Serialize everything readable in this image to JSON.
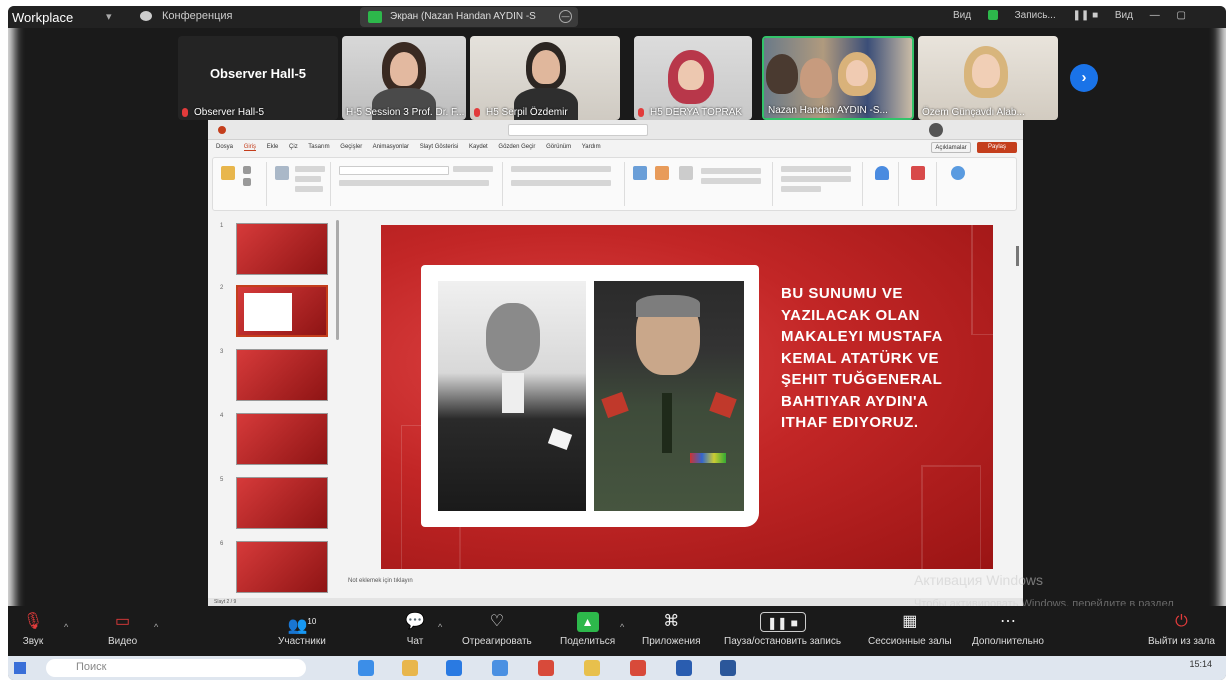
{
  "titlebar": {
    "app": "Workplace",
    "conference": "Конференция",
    "tab": "Экран (Nazan Handan AYDIN -S",
    "view": "Вид",
    "recording": "Запись...",
    "layout": "Вид"
  },
  "participants": [
    {
      "big": "Observer Hall-5",
      "name": "Observer Hall-5"
    },
    {
      "name": "H-5 Session 3 Prof. Dr. F..."
    },
    {
      "name": "H5 Serpil Özdemir"
    },
    {
      "name": "H5 DERYA TOPRAK"
    },
    {
      "name": "Nazan Handan AYDIN -S..."
    },
    {
      "name": "Özem Günçavdı Alab..."
    }
  ],
  "ppt": {
    "tabs": [
      "Dosya",
      "Giriş",
      "Ekle",
      "Çiz",
      "Tasarım",
      "Geçişler",
      "Animasyonlar",
      "Slayt Gösterisi",
      "Kaydet",
      "Gözden Geçir",
      "Görünüm",
      "Yardım"
    ],
    "comments": "Açıklamalar",
    "share": "Paylaş",
    "notes": "Not eklemek için tıklayın",
    "status": "Slayt 2 / 9"
  },
  "slide": {
    "text": "BU SUNUMU VE YAZILACAK OLAN MAKALEYI MUSTAFA KEMAL ATATÜRK VE ŞEHIT TUĞGENERAL BAHTIYAR AYDIN'A ITHAF EDIYORUZ."
  },
  "watermark": {
    "title": "Активация Windows",
    "text": "Чтобы активировать Windows, перейдите в раздел \"Параметры\"."
  },
  "toolbar": {
    "audio": "Звук",
    "video": "Видео",
    "participants_count": "10",
    "participants": "Участники",
    "chat": "Чат",
    "react": "Отреагировать",
    "share": "Поделиться",
    "apps": "Приложения",
    "record": "Пауза/остановить запись",
    "breakout": "Сессионные залы",
    "more": "Дополнительно",
    "leave": "Выйти из зала"
  },
  "taskbar": {
    "search": "Поиск",
    "time": "15:14"
  }
}
